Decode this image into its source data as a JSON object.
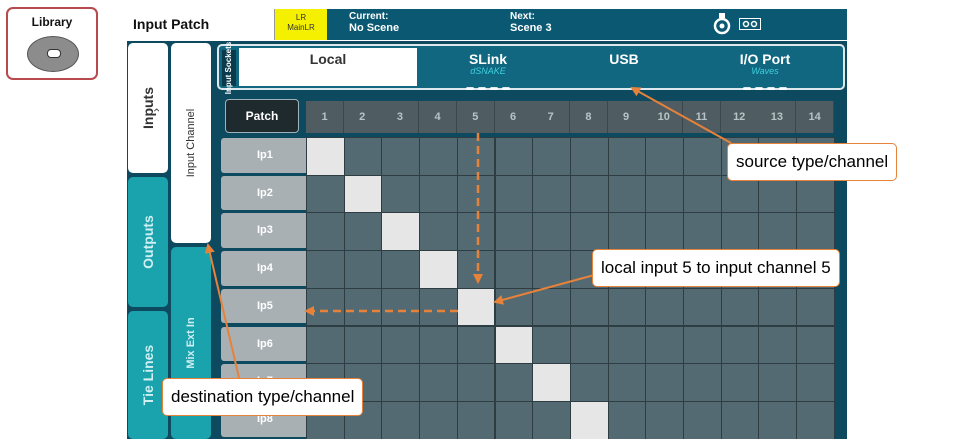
{
  "library": {
    "label": "Library"
  },
  "header": {
    "title": "Input Patch",
    "mix_top": "LR",
    "mix_bottom": "MainLR",
    "current_label": "Current:",
    "current_value": "No Scene",
    "next_label": "Next:",
    "next_value": "Scene 3",
    "icon1": "usb-stick-icon",
    "icon2": "link-icon"
  },
  "left_tabs": {
    "inputs": "Inputs",
    "outputs": "Outputs",
    "tie_lines": "Tie Lines",
    "input_channel": "Input Channel",
    "mix_ext_in": "Mix Ext In"
  },
  "sockets": {
    "label": "Input Sockets",
    "tabs": [
      {
        "name": "Local",
        "sub": ""
      },
      {
        "name": "SLink",
        "sub": "dSNAKE"
      },
      {
        "name": "USB",
        "sub": ""
      },
      {
        "name": "I/O Port",
        "sub": "Waves"
      }
    ]
  },
  "grid": {
    "patch_button": "Patch",
    "columns": [
      "1",
      "2",
      "3",
      "4",
      "5",
      "6",
      "7",
      "8",
      "9",
      "10",
      "11",
      "12",
      "13",
      "14"
    ],
    "rows": [
      "Ip1",
      "Ip2",
      "Ip3",
      "Ip4",
      "Ip5",
      "Ip6",
      "Ip7",
      "Ip8"
    ],
    "patched": [
      [
        0,
        0
      ],
      [
        1,
        1
      ],
      [
        2,
        2
      ],
      [
        3,
        3
      ],
      [
        4,
        4
      ],
      [
        5,
        5
      ],
      [
        6,
        6
      ],
      [
        7,
        7
      ]
    ]
  },
  "annotations": {
    "source": "source type/channel",
    "local": "local input 5 to input channel 5",
    "destination": "destination type/channel",
    "color": "#e6823a"
  }
}
